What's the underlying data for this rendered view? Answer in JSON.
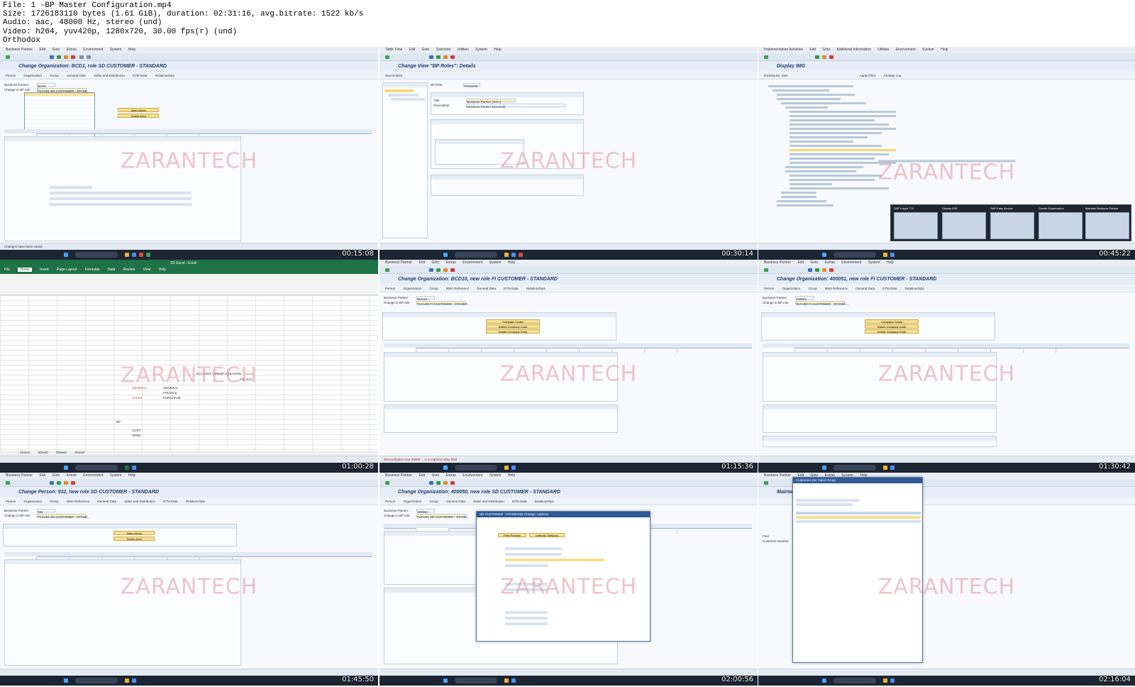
{
  "file_info": {
    "line1": "File: 1 -BP Master Configuration.mp4",
    "line2": "Size: 1726183110 bytes (1.61 GiB), duration: 02:31:16, avg.bitrate: 1522 kb/s",
    "line3": "Audio: aac, 48000 Hz, stereo (und)",
    "line4": "Video: h264, yuv420p, 1280x720, 30.00 fps(r) (und)",
    "line5": "Orthodox"
  },
  "watermark": "ZARANTECH",
  "colors": {
    "sap_bg": "#f2f6fb",
    "taskbar": "#1d2533",
    "highlight": "#f8e08f",
    "excel_green": "#1f7245",
    "watermark": "#e096a0"
  },
  "thumbnails": [
    {
      "timestamp": "00:15:08",
      "title": "Change Organization: BCD1, role SD CUSTOMER - STANDARD",
      "menu": [
        "Business Partner",
        "Edit",
        "Goto",
        "Extras",
        "Environment",
        "System",
        "Help"
      ],
      "toolbar": [
        "Person",
        "Organization",
        "Group",
        "General Data",
        "Sales and Distribution",
        "ETM Data",
        "Relationships"
      ],
      "fields": [
        {
          "label": "Business Partner",
          "value": "BCD1"
        },
        {
          "label": "Change in BP role",
          "value": "FLCU01 SD CUSTOMER - STAND..."
        }
      ],
      "buttons": [
        "Sales Areas",
        "Switch Area"
      ],
      "status": "Changes have been saved"
    },
    {
      "timestamp": "00:30:14",
      "title": "Change View \"BP Roles\": Details",
      "menu": [
        "Table View",
        "Edit",
        "Goto",
        "Selection",
        "Utilities",
        "System",
        "Help"
      ],
      "toolbar": [
        "New Entries"
      ],
      "fields": [
        {
          "label": "BP Role",
          "value": "FRO0000"
        },
        {
          "label": "Title",
          "value": "Business Partner (Gen.)"
        },
        {
          "label": "Description",
          "value": "Business Partner (General)"
        }
      ],
      "buttons": [],
      "status": ""
    },
    {
      "timestamp": "00:45:22",
      "title": "Display IMG",
      "menu": [
        "Implementation Activities",
        "Edit",
        "Goto",
        "Additional Information",
        "Utilities",
        "Environment",
        "System",
        "Help"
      ],
      "toolbar": [
        "Existing BC Sets",
        "Apply Filter",
        "Change Log"
      ],
      "fields": [],
      "buttons": [],
      "status": "",
      "switcher": [
        "SAP Logon 770",
        "Display IMG",
        "SAP Easy Access",
        "Create Organization",
        "Maintain Business Partner"
      ]
    },
    {
      "timestamp": "01:00:28",
      "title": "SD Excel - Excel",
      "menu": [
        "File",
        "Home",
        "Insert",
        "Page Layout",
        "Formulas",
        "Data",
        "Review",
        "View",
        "Help"
      ],
      "toolbar": [],
      "fields": [],
      "buttons": [],
      "status": "",
      "cells": [
        "ACCOUNT GROUP CREATION",
        "FIN ACC",
        "GENERAL",
        "GENERAL",
        "FINANCE",
        "PURCHASE",
        "BP",
        "SALES",
        "CUST",
        "VEND"
      ],
      "sheets": [
        "Sheet1",
        "Sheet2",
        "Sheet3",
        "Sheet4"
      ]
    },
    {
      "timestamp": "01:15:36",
      "title": "Change Organization: BCD10, new role FI CUSTOMER - STANDARD",
      "menu": [
        "Business Partner",
        "Edit",
        "Goto",
        "Extras",
        "Environment",
        "System",
        "Help"
      ],
      "toolbar": [
        "Person",
        "Organization",
        "Group",
        "BWA Reference",
        "General Data",
        "ETM Data",
        "Relationships"
      ],
      "fields": [
        {
          "label": "Business Partner",
          "value": "BCD10"
        },
        {
          "label": "Change in BP role",
          "value": "FLCU00 FI CUSTOMER - STANDA..."
        }
      ],
      "buttons": [
        "Company Codes",
        "Switch Company Code",
        "Delete Company Code"
      ],
      "status": "Reconciliation acct 20900 ... is a required entry field"
    },
    {
      "timestamp": "01:30:42",
      "title": "Change Organization: 400051, new role FI CUSTOMER - STANDARD",
      "menu": [
        "Business Partner",
        "Edit",
        "Goto",
        "Extras",
        "Environment",
        "System",
        "Help"
      ],
      "toolbar": [
        "Person",
        "Organization",
        "Group",
        "BWA Reference",
        "General Data",
        "ETM Data",
        "Relationships"
      ],
      "fields": [
        {
          "label": "Business Partner",
          "value": "400051"
        },
        {
          "label": "Change in BP role",
          "value": "FLCU00 FI CUSTOMER - STANDA..."
        }
      ],
      "buttons": [
        "Company Codes",
        "Switch Company Code",
        "Delete Company Code"
      ],
      "status": ""
    },
    {
      "timestamp": "01:45:50",
      "title": "Change Person: 932, new role SD CUSTOMER - STANDARD",
      "menu": [
        "Business Partner",
        "Edit",
        "Goto",
        "Extras",
        "Environment",
        "System",
        "Help"
      ],
      "toolbar": [
        "Person",
        "Organization",
        "Group",
        "BWA Reference",
        "General Data",
        "Sales and Distribution",
        "ETM Data",
        "Relationships"
      ],
      "fields": [
        {
          "label": "Business Partner",
          "value": "932"
        },
        {
          "label": "Change in BP role",
          "value": "FLCU01 SD CUSTOMER - STAND..."
        }
      ],
      "buttons": [
        "Sales Areas",
        "Switch Area"
      ],
      "status": ""
    },
    {
      "timestamp": "02:00:56",
      "title": "Change Organization: 400050, new role SD CUSTOMER - STANDARD",
      "menu": [
        "Business Partner",
        "Edit",
        "Goto",
        "Extras",
        "Environment",
        "System",
        "Help"
      ],
      "toolbar": [
        "Person",
        "Organization",
        "Group",
        "General Data",
        "Sales and Distribution",
        "ETM Data",
        "Relationships"
      ],
      "fields": [
        {
          "label": "Business Partner",
          "value": "400050"
        },
        {
          "label": "Change in BP role",
          "value": "FLCU01 SD CUSTOMER - STAND..."
        }
      ],
      "buttons": [
        "Print Preview",
        "Internat. Versions"
      ],
      "status": "",
      "dialog": "SD CUSTOMER - STANDARD Change: Address"
    },
    {
      "timestamp": "02:16:04",
      "title": "Maintain Business Partner",
      "menu": [
        "Business Partner",
        "Edit",
        "Goto",
        "Extras",
        "System",
        "Help"
      ],
      "toolbar": [],
      "fields": [
        {
          "label": "Find",
          "value": ""
        },
        {
          "label": "Customer Number",
          "value": ""
        }
      ],
      "buttons": [],
      "status": "",
      "dialog": "Customers per Sales Group"
    }
  ]
}
